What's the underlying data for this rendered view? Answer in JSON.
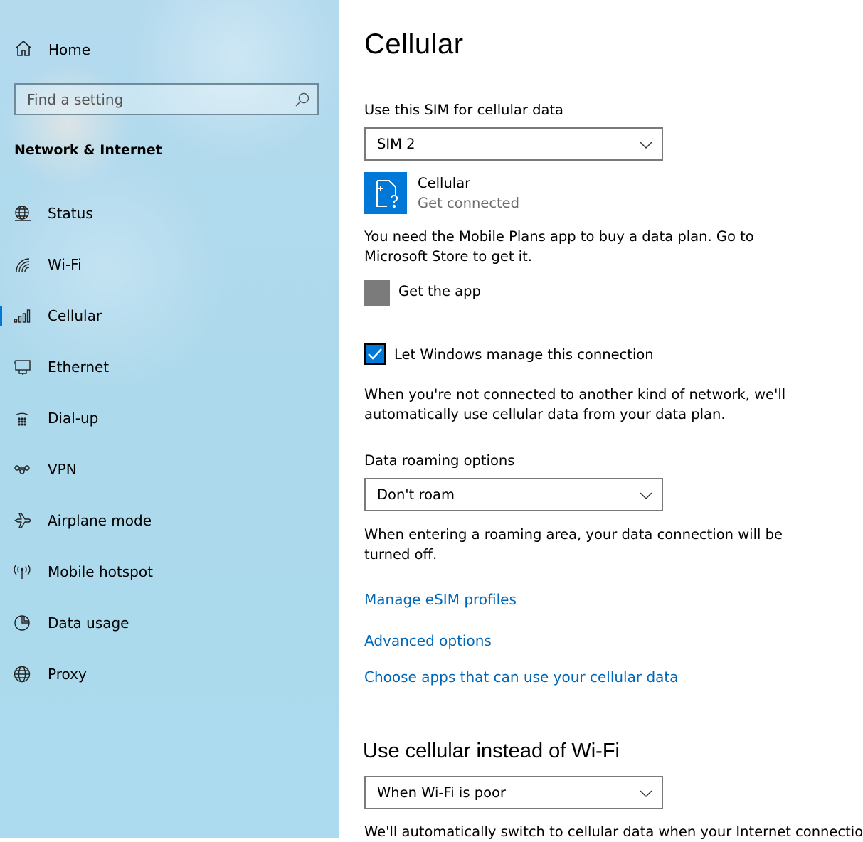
{
  "sidebar": {
    "home_label": "Home",
    "search_placeholder": "Find a setting",
    "section_title": "Network & Internet",
    "items": [
      {
        "label": "Status",
        "icon": "globe-status-icon"
      },
      {
        "label": "Wi-Fi",
        "icon": "wifi-icon"
      },
      {
        "label": "Cellular",
        "icon": "cellular-signal-icon",
        "active": true
      },
      {
        "label": "Ethernet",
        "icon": "ethernet-icon"
      },
      {
        "label": "Dial-up",
        "icon": "dialup-phone-icon"
      },
      {
        "label": "VPN",
        "icon": "vpn-icon"
      },
      {
        "label": "Airplane mode",
        "icon": "airplane-icon"
      },
      {
        "label": "Mobile hotspot",
        "icon": "hotspot-icon"
      },
      {
        "label": "Data usage",
        "icon": "pie-chart-icon"
      },
      {
        "label": "Proxy",
        "icon": "globe-icon"
      }
    ]
  },
  "main": {
    "title": "Cellular",
    "sim_label": "Use this SIM for cellular data",
    "sim_value": "SIM 2",
    "connection": {
      "name": "Cellular",
      "status": "Get connected"
    },
    "plan_text": "You need the Mobile Plans app to buy a data plan. Go to Microsoft Store to get it.",
    "get_app": "Get the app",
    "manage_label": "Let Windows manage this connection",
    "manage_checked": true,
    "manage_desc": "When you're not connected to another kind of network, we'll automatically use cellular data from your data plan.",
    "roaming_label": "Data roaming options",
    "roaming_value": "Don't roam",
    "roaming_desc": "When entering a roaming area, your data connection will be turned off.",
    "links": [
      "Manage eSIM profiles",
      "Advanced options",
      "Choose apps that can use your cellular data"
    ],
    "wifi_heading": "Use cellular instead of Wi-Fi",
    "wifi_value": "When Wi-Fi is poor",
    "wifi_desc": "We'll automatically switch to cellular data when your Internet connection"
  },
  "colors": {
    "accent": "#0078d7",
    "link": "#0067b8",
    "sidebar_bg": "#acd9ec"
  }
}
